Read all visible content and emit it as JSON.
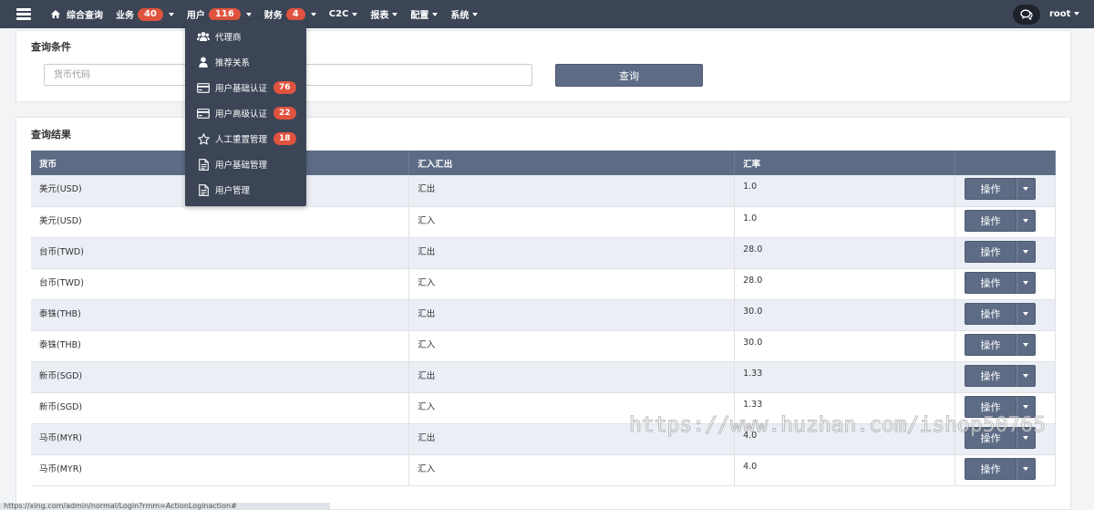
{
  "nav": {
    "items": [
      {
        "label": "综合查询",
        "badge": null,
        "dropdown": false
      },
      {
        "label": "业务",
        "badge": "40",
        "dropdown": true
      },
      {
        "label": "用户",
        "badge": "116",
        "dropdown": true
      },
      {
        "label": "财务",
        "badge": "4",
        "dropdown": true
      },
      {
        "label": "C2C",
        "badge": null,
        "dropdown": true
      },
      {
        "label": "报表",
        "badge": null,
        "dropdown": true
      },
      {
        "label": "配置",
        "badge": null,
        "dropdown": true
      },
      {
        "label": "系统",
        "badge": null,
        "dropdown": true
      }
    ],
    "user": "root"
  },
  "user_menu": {
    "items": [
      {
        "label": "代理商",
        "icon": "users-icon",
        "badge": null
      },
      {
        "label": "推荐关系",
        "icon": "user-icon",
        "badge": null
      },
      {
        "label": "用户基础认证",
        "icon": "card-icon",
        "badge": "76"
      },
      {
        "label": "用户高级认证",
        "icon": "card-icon",
        "badge": "22"
      },
      {
        "label": "人工重置管理",
        "icon": "star-icon",
        "badge": "18"
      },
      {
        "label": "用户基础管理",
        "icon": "document-icon",
        "badge": null
      },
      {
        "label": "用户管理",
        "icon": "document-icon",
        "badge": null
      }
    ]
  },
  "query": {
    "title": "查询条件",
    "placeholder": "货币代码",
    "button": "查询"
  },
  "result": {
    "title": "查询结果",
    "columns": [
      "货币",
      "汇入汇出",
      "汇率",
      ""
    ],
    "action_label": "操作",
    "rows": [
      {
        "currency": "美元(USD)",
        "direction": "汇出",
        "rate": "1.0"
      },
      {
        "currency": "美元(USD)",
        "direction": "汇入",
        "rate": "1.0"
      },
      {
        "currency": "台币(TWD)",
        "direction": "汇出",
        "rate": "28.0"
      },
      {
        "currency": "台币(TWD)",
        "direction": "汇入",
        "rate": "28.0"
      },
      {
        "currency": "泰铢(THB)",
        "direction": "汇出",
        "rate": "30.0"
      },
      {
        "currency": "泰铢(THB)",
        "direction": "汇入",
        "rate": "30.0"
      },
      {
        "currency": "新币(SGD)",
        "direction": "汇出",
        "rate": "1.33"
      },
      {
        "currency": "新币(SGD)",
        "direction": "汇入",
        "rate": "1.33"
      },
      {
        "currency": "马币(MYR)",
        "direction": "汇出",
        "rate": "4.0"
      },
      {
        "currency": "马币(MYR)",
        "direction": "汇入",
        "rate": "4.0"
      }
    ]
  },
  "status_url": "https://xing.com/admin/normal/Login?rmm=ActionLoginaction#",
  "watermark": "https://www.huzhan.com/ishop50765",
  "colors": {
    "nav_bg": "#3b4556",
    "badge": "#e0533f",
    "header_bg": "#5d6b85",
    "row_alt": "#ebeef5"
  }
}
